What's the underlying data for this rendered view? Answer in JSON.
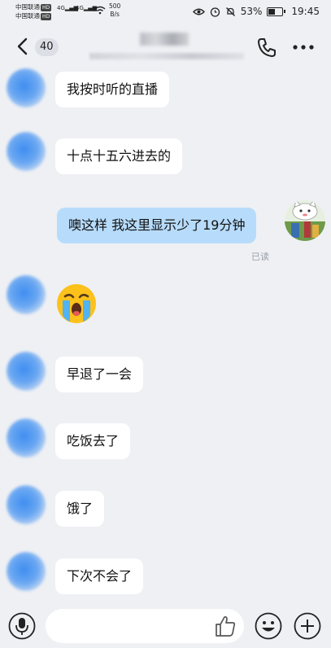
{
  "status_bar": {
    "carrier_1": "中国联通",
    "carrier_2": "中国联通",
    "hd_badge": "HD",
    "signal_1": "4G",
    "signal_2": "4G",
    "net_speed_value": "500",
    "net_speed_unit": "B/s",
    "battery_percent": "53%",
    "battery_level": 0.53,
    "time": "19:45"
  },
  "header": {
    "unread_count": "40",
    "back_icon": "back-arrow-icon",
    "call_icon": "phone-icon",
    "more_icon": "more-dots-icon"
  },
  "messages": [
    {
      "sender": "other",
      "text": "我按时听的直播"
    },
    {
      "sender": "other",
      "text": "十点十五六进去的"
    },
    {
      "sender": "me",
      "text": "噢这样 我这里显示少了19分钟",
      "status": "已读"
    },
    {
      "sender": "other",
      "emoji": "crying-face-emoji"
    },
    {
      "sender": "other",
      "text": "早退了一会"
    },
    {
      "sender": "other",
      "text": "吃饭去了"
    },
    {
      "sender": "other",
      "text": "饿了"
    },
    {
      "sender": "other",
      "text": "下次不会了"
    }
  ],
  "input_bar": {
    "value": "",
    "icons": [
      "microphone-icon",
      "thumbs-up-icon",
      "emoji-icon",
      "plus-icon"
    ]
  },
  "colors": {
    "background": "#eef0f4",
    "my_bubble": "#b7dcfb",
    "their_bubble": "#ffffff"
  }
}
